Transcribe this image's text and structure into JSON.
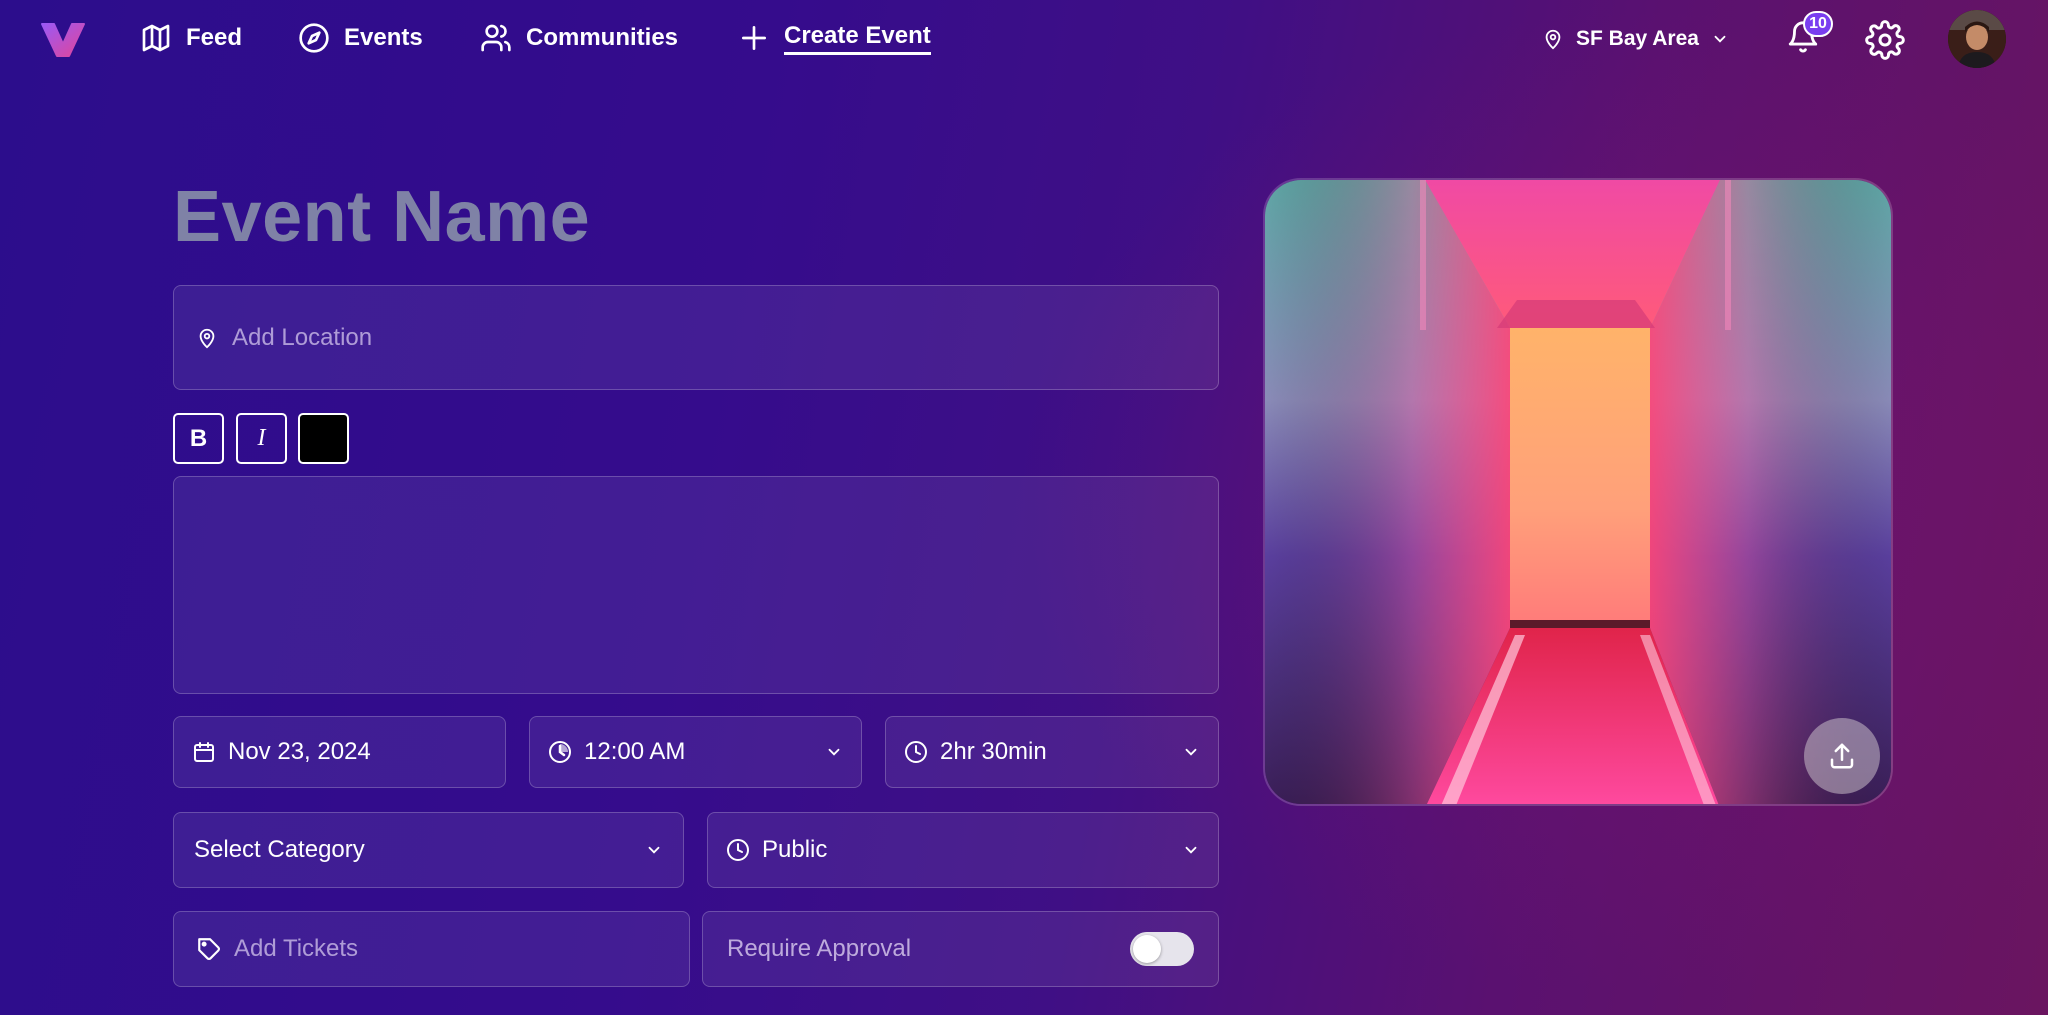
{
  "nav": {
    "items": [
      {
        "label": "Feed",
        "icon": "map-icon"
      },
      {
        "label": "Events",
        "icon": "compass-icon"
      },
      {
        "label": "Communities",
        "icon": "users-icon"
      },
      {
        "label": "Create Event",
        "icon": "plus-icon",
        "active": true
      }
    ],
    "location": "SF Bay Area",
    "notifications_count": "10"
  },
  "form": {
    "event_name_placeholder": "Event Name",
    "location_placeholder": "Add Location",
    "format": {
      "bold": "B",
      "italic": "I",
      "text_color": "#000000"
    },
    "description": "",
    "date": "Nov 23, 2024",
    "time": "12:00 AM",
    "duration": "2hr 30min",
    "category": "Select Category",
    "visibility": "Public",
    "tickets_placeholder": "Add Tickets",
    "require_approval_label": "Require Approval",
    "require_approval_on": false
  },
  "colors": {
    "background_start": "#2c0d8c",
    "background_end": "#6a1560",
    "badge": "#7a3df0",
    "placeholder_text": "#7f82a6"
  }
}
